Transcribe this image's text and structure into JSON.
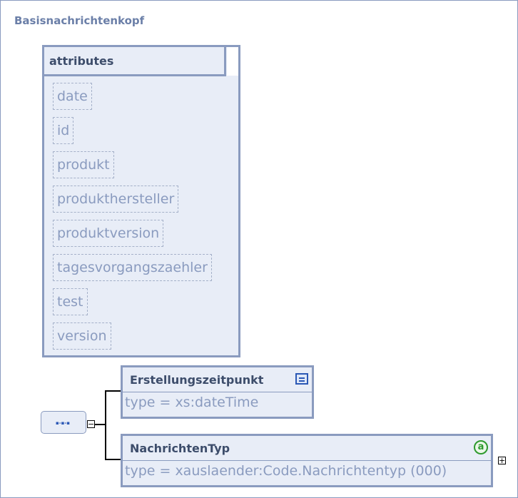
{
  "title": "Basisnachrichtenkopf",
  "attributes": {
    "header": "attributes",
    "items": [
      "date",
      "id",
      "produkt",
      "produkthersteller",
      "produktversion",
      "tagesvorgangszaehler",
      "test",
      "version"
    ]
  },
  "sequence": {
    "dots": "▪-▪-▪",
    "toggle": "−"
  },
  "elements": [
    {
      "name": "Erstellungszeitpunkt",
      "type": "type = xs:dateTime",
      "icon": "documentation-icon"
    },
    {
      "name": "NachrichtenTyp",
      "type": "type = xauslaender:Code.Nachrichtentyp (000)",
      "icon": "attribute-icon",
      "badge": "a",
      "toggle": "+"
    }
  ],
  "colors": {
    "border": "#8a9bbf",
    "fill": "#e8edf7",
    "text_dark": "#3d4d6b",
    "text_light": "#8a9bbf",
    "accent": "#2b58b5",
    "badge": "#2e9a2e"
  }
}
